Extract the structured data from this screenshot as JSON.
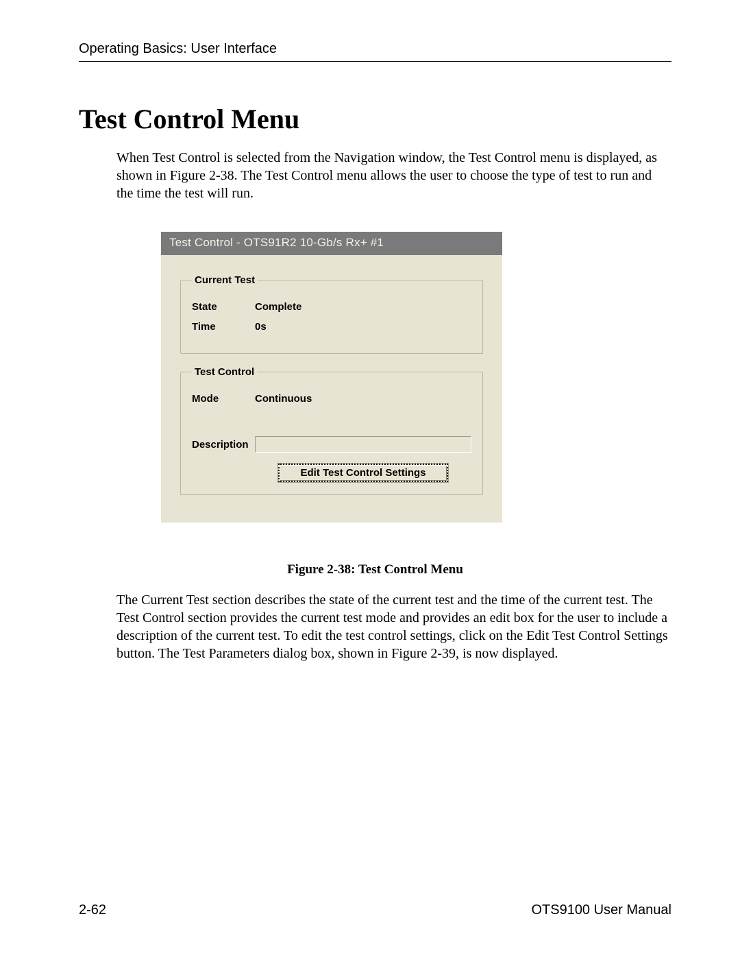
{
  "header": {
    "running_head": "Operating Basics: User Interface"
  },
  "title": "Test Control Menu",
  "intro_text": "When Test Control is selected from the Navigation window, the Test Control menu is displayed, as shown in Figure 2-38.  The Test Control menu allows the user to choose the type of test to run and the time the test will run.",
  "figure": {
    "titlebar": "Test Control - OTS91R2 10-Gb/s Rx+ #1",
    "group_current": {
      "legend": "Current Test",
      "state_label": "State",
      "state_value": "Complete",
      "time_label": "Time",
      "time_value": "0s"
    },
    "group_control": {
      "legend": "Test Control",
      "mode_label": "Mode",
      "mode_value": "Continuous",
      "description_label": "Description",
      "description_value": "",
      "button_label": "Edit Test Control Settings"
    },
    "caption": "Figure 2-38: Test Control Menu"
  },
  "outro_text": "The Current Test section describes the state of the current test and the time of the current test.  The Test Control section provides the current test mode and provides an edit box for the user to include a description of the current test.  To edit the test control settings, click on the Edit Test Control Settings button.  The Test Parameters dialog box, shown in Figure 2-39, is now displayed.",
  "footer": {
    "page_number": "2-62",
    "doc_title": "OTS9100 User Manual"
  }
}
